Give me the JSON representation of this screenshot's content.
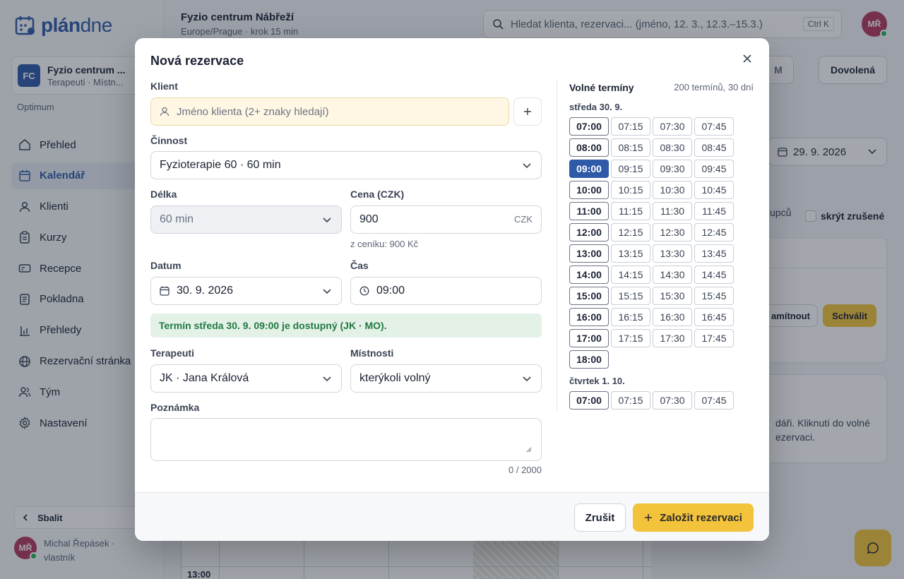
{
  "app": {
    "brand_part1": "plán",
    "brand_part2": "dne"
  },
  "org": {
    "initials": "FC",
    "name": "Fyzio centrum ...",
    "sub": "Terapeuti · Místn...",
    "plan": "Optimum"
  },
  "nav": {
    "items": [
      {
        "label": "Přehled",
        "icon": "home-icon"
      },
      {
        "label": "Kalendář",
        "icon": "calendar-icon",
        "active": true
      },
      {
        "label": "Klienti",
        "icon": "user-icon"
      },
      {
        "label": "Kurzy",
        "icon": "clipboard-icon"
      },
      {
        "label": "Recepce",
        "icon": "card-icon"
      },
      {
        "label": "Pokladna",
        "icon": "receipt-icon"
      },
      {
        "label": "Přehledy",
        "icon": "bar-chart-icon"
      },
      {
        "label": "Rezervační stránka",
        "icon": "globe-icon"
      },
      {
        "label": "Tým",
        "icon": "team-icon"
      },
      {
        "label": "Nastavení",
        "icon": "gear-icon"
      }
    ]
  },
  "collapse_label": "Sbalit",
  "user": {
    "initials": "MŘ",
    "name": "Michal Řepásek · vlastník"
  },
  "topbar": {
    "title": "Fyzio centrum Nábřeží",
    "sub": "Europe/Prague · krok 15 min",
    "search_placeholder": "Hledat klienta, rezervaci... (jméno, 12. 3., 12.3.–15.3.)",
    "shortcut": "Ctrl K"
  },
  "background": {
    "m_btn": "M",
    "vacation_btn": "Dovolená",
    "date": "29. 9. 2026",
    "groups_frag": "upců",
    "hide_cancelled": "skrýt zrušené",
    "reject_btn": "amítnout",
    "approve_btn": "Schválit",
    "info_line1": "dáři. Kliknutí do volné",
    "info_line2": "ezervaci.",
    "time_13": "13:00"
  },
  "modal": {
    "title": "Nová rezervace",
    "client_label": "Klient",
    "client_placeholder": "Jméno klienta (2+ znaky hledají)",
    "activity_label": "Činnost",
    "activity_value": "Fyzioterapie 60 · 60 min",
    "duration_label": "Délka",
    "duration_value": "60 min",
    "price_label": "Cena (CZK)",
    "price_value": "900",
    "price_unit": "CZK",
    "price_hint": "z ceníku: 900 Kč",
    "date_label": "Datum",
    "date_value": "30. 9. 2026",
    "time_label": "Čas",
    "time_value": "09:00",
    "availability": "Termín středa 30. 9. 09:00 je dostupný (JK · MO).",
    "therapists_label": "Terapeuti",
    "therapist_value": "JK · Jana Králová",
    "rooms_label": "Místnosti",
    "room_value": "kterýkoli volný",
    "note_label": "Poznámka",
    "note_counter": "0 / 2000",
    "cancel_btn": "Zrušit",
    "create_btn": "Založit rezervaci"
  },
  "slots": {
    "title": "Volné termíny",
    "summary": "200 termínů, 30 dní",
    "selected": "09:00",
    "days": [
      {
        "label": "středa 30. 9.",
        "times": [
          "07:00",
          "07:15",
          "07:30",
          "07:45",
          "08:00",
          "08:15",
          "08:30",
          "08:45",
          "09:00",
          "09:15",
          "09:30",
          "09:45",
          "10:00",
          "10:15",
          "10:30",
          "10:45",
          "11:00",
          "11:15",
          "11:30",
          "11:45",
          "12:00",
          "12:15",
          "12:30",
          "12:45",
          "13:00",
          "13:15",
          "13:30",
          "13:45",
          "14:00",
          "14:15",
          "14:30",
          "14:45",
          "15:00",
          "15:15",
          "15:30",
          "15:45",
          "16:00",
          "16:15",
          "16:30",
          "16:45",
          "17:00",
          "17:15",
          "17:30",
          "17:45",
          "18:00"
        ]
      },
      {
        "label": "čtvrtek 1. 10.",
        "times": [
          "07:00",
          "07:15",
          "07:30",
          "07:45"
        ]
      }
    ]
  },
  "colors": {
    "brand": "#2f5aa8",
    "accent": "#f2c33b",
    "success": "#217a42"
  }
}
